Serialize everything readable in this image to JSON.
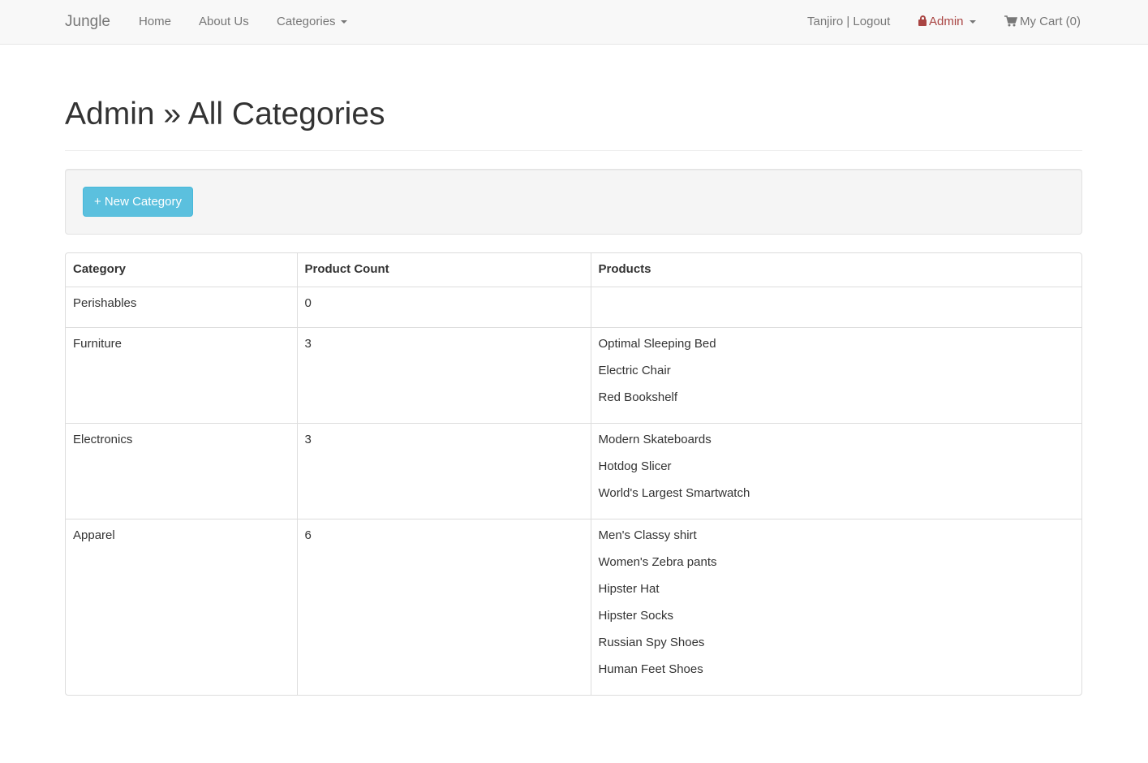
{
  "navbar": {
    "brand": "Jungle",
    "home": "Home",
    "about": "About Us",
    "categories": "Categories",
    "user": "Tanjiro | Logout",
    "admin": "Admin",
    "cart": "My Cart (0)"
  },
  "colors": {
    "admin": "#a94442",
    "button": "#5bc0de"
  },
  "page": {
    "title": "Admin » All Categories"
  },
  "actions": {
    "new_category": "+ New Category"
  },
  "table": {
    "headers": [
      "Category",
      "Product Count",
      "Products"
    ],
    "rows": [
      {
        "category": "Perishables",
        "count": "0",
        "products": []
      },
      {
        "category": "Furniture",
        "count": "3",
        "products": [
          "Optimal Sleeping Bed",
          "Electric Chair",
          "Red Bookshelf"
        ]
      },
      {
        "category": "Electronics",
        "count": "3",
        "products": [
          "Modern Skateboards",
          "Hotdog Slicer",
          "World's Largest Smartwatch"
        ]
      },
      {
        "category": "Apparel",
        "count": "6",
        "products": [
          "Men's Classy shirt",
          "Women's Zebra pants",
          "Hipster Hat",
          "Hipster Socks",
          "Russian Spy Shoes",
          "Human Feet Shoes"
        ]
      }
    ]
  }
}
